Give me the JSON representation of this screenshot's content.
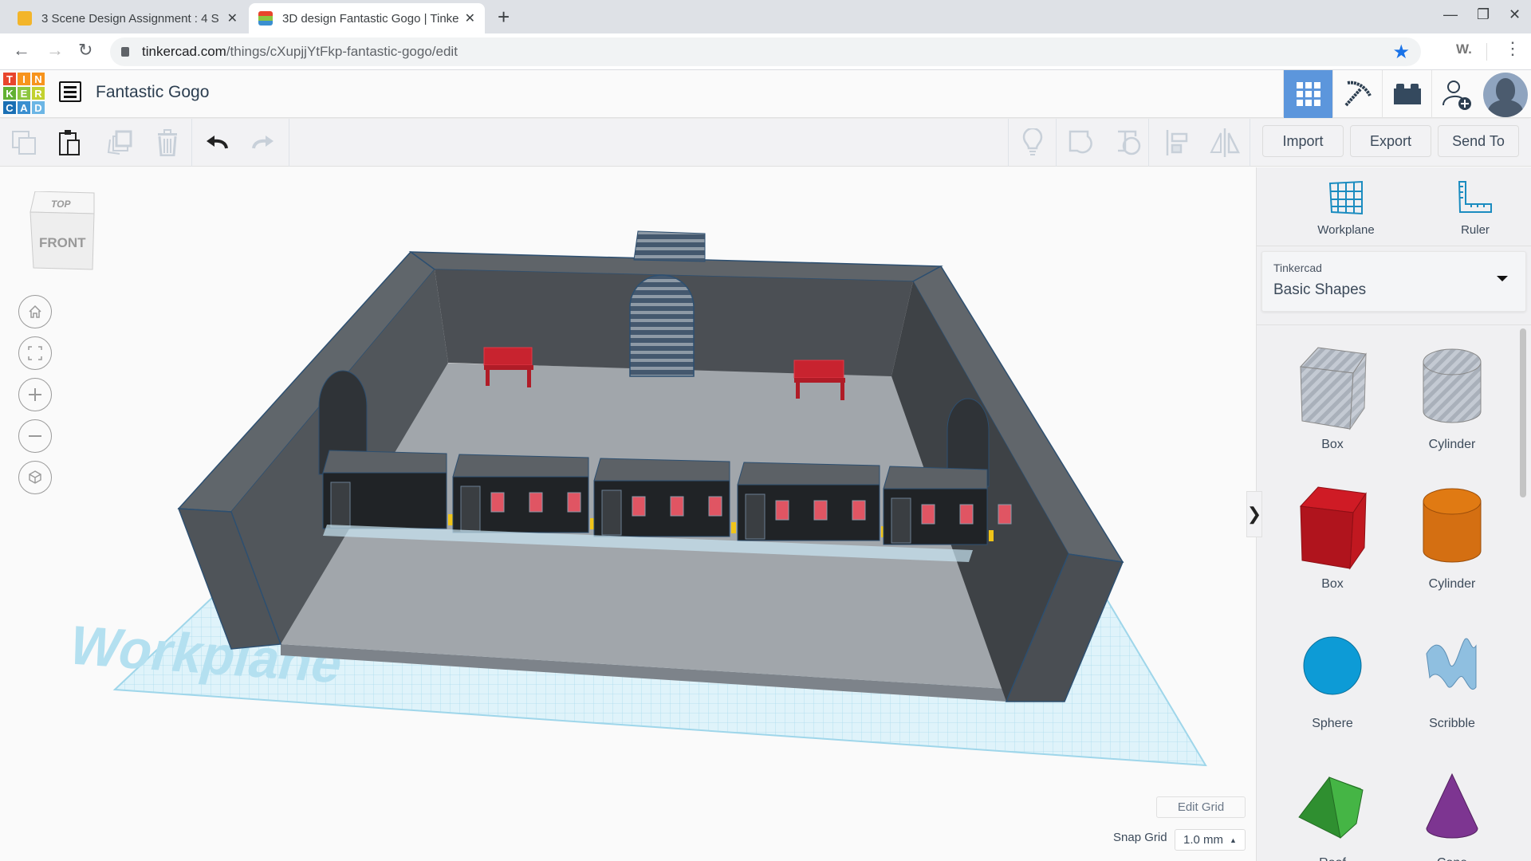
{
  "browser": {
    "tabs": [
      {
        "title": "3 Scene Design Assignment : 4 S",
        "active": false,
        "favicon": "robot-favicon"
      },
      {
        "title": "3D design Fantastic Gogo | Tinke",
        "active": true,
        "favicon": "tinkercad-favicon"
      }
    ],
    "new_tab": "+",
    "url_host": "tinkercad.com",
    "url_path": "/things/cXupjjYtFkp-fantastic-gogo/edit",
    "extension_label": "W.",
    "colors": {
      "star": "#1a73e8"
    }
  },
  "app": {
    "logo_letters": [
      "T",
      "I",
      "N",
      "K",
      "E",
      "R",
      "C",
      "A",
      "D"
    ],
    "logo_colors": [
      "#e8452c",
      "#f7941d",
      "#f7941d",
      "#62b032",
      "#8dc63f",
      "#c2d130",
      "#1a6fb4",
      "#3b8fd0",
      "#6cb6e5"
    ],
    "design_title": "Fantastic Gogo",
    "header_buttons": [
      "3d-design-view",
      "codeblocks",
      "bricks",
      "invite-users"
    ],
    "accent": "#5c96dc"
  },
  "toolbar": {
    "left_tools": [
      "copy",
      "paste",
      "duplicate",
      "delete",
      "undo",
      "redo"
    ],
    "right_tools": [
      "show-notes",
      "group",
      "ungroup",
      "align",
      "mirror"
    ],
    "import_label": "Import",
    "export_label": "Export",
    "send_to_label": "Send To"
  },
  "viewport": {
    "viewcube": {
      "top": "TOP",
      "front": "FRONT"
    },
    "controls": [
      "home-view",
      "fit-all",
      "zoom-in",
      "zoom-out",
      "perspective"
    ],
    "workplane_label": "Workplane",
    "edit_grid_label": "Edit Grid",
    "snap_grid_label": "Snap Grid",
    "snap_grid_value": "1.0 mm"
  },
  "panel": {
    "workplane_label": "Workplane",
    "ruler_label": "Ruler",
    "library_group": "Tinkercad",
    "library_name": "Basic Shapes",
    "shapes": [
      {
        "label": "Box",
        "kind": "box-hole"
      },
      {
        "label": "Cylinder",
        "kind": "cylinder-hole"
      },
      {
        "label": "Box",
        "kind": "box",
        "color": "#c8161d"
      },
      {
        "label": "Cylinder",
        "kind": "cylinder",
        "color": "#e07a13"
      },
      {
        "label": "Sphere",
        "kind": "sphere",
        "color": "#0d9bd6"
      },
      {
        "label": "Scribble",
        "kind": "scribble",
        "color": "#8fbfe0"
      },
      {
        "label": "Roof",
        "kind": "roof",
        "color": "#3faa3f"
      },
      {
        "label": "Cone",
        "kind": "cone",
        "color": "#7d3591"
      }
    ]
  }
}
